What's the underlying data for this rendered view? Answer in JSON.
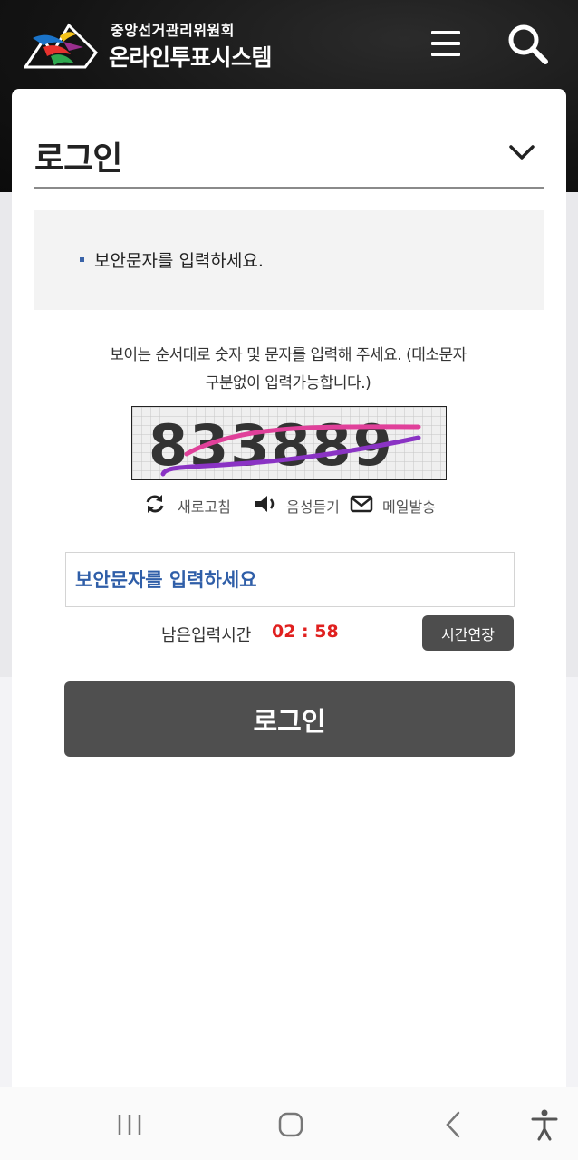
{
  "header": {
    "org_name": "중앙선거관리위원회",
    "system_name": "온라인투표시스템",
    "menu_icon": "hamburger-menu-icon",
    "search_icon": "search-icon"
  },
  "login": {
    "title": "로그인",
    "notice": "보안문자를 입력하세요.",
    "guide_line1": "보이는 순서대로 숫자 및 문자를 입력해 주세요. (대소문자",
    "guide_line2": "구분없이 입력가능합니다.)",
    "captcha_text": "833889",
    "refresh_label": "새로고침",
    "audio_label": "음성듣기",
    "email_label": "메일발송",
    "input_placeholder": "보안문자를 입력하세요",
    "timer_label": "남은입력시간",
    "timer_value": "02 : 58",
    "extend_label": "시간연장",
    "submit_label": "로그인"
  },
  "colors": {
    "header_bg": "#141414",
    "accent_blue": "#2f5ea8",
    "timer_red": "#e0201f",
    "button_dark": "#4f4f4f"
  }
}
